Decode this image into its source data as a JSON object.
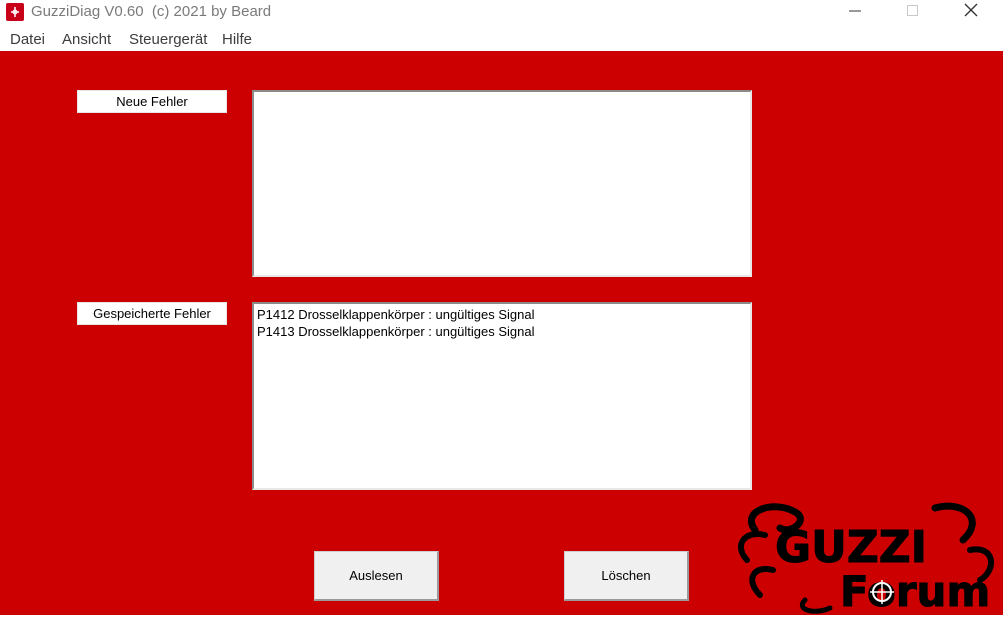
{
  "window": {
    "title": "GuzziDiag V0.60  (c) 2021 by Beard"
  },
  "menu": {
    "items": [
      "Datei",
      "Ansicht",
      "Steuergerät",
      "Hilfe"
    ]
  },
  "sections": {
    "new_faults_label": "Neue Fehler",
    "stored_faults_label": "Gespeicherte Fehler"
  },
  "new_faults": [],
  "stored_faults": [
    "P1412 Drosselklappenkörper : ungültiges Signal",
    "P1413 Drosselklappenkörper : ungültiges Signal"
  ],
  "buttons": {
    "read_label": "Auslesen",
    "delete_label": "Löschen"
  },
  "logo": {
    "line1": "GUZZI",
    "line2": "Forum"
  },
  "colors": {
    "background": "#cc0000",
    "logo": "#000000"
  }
}
